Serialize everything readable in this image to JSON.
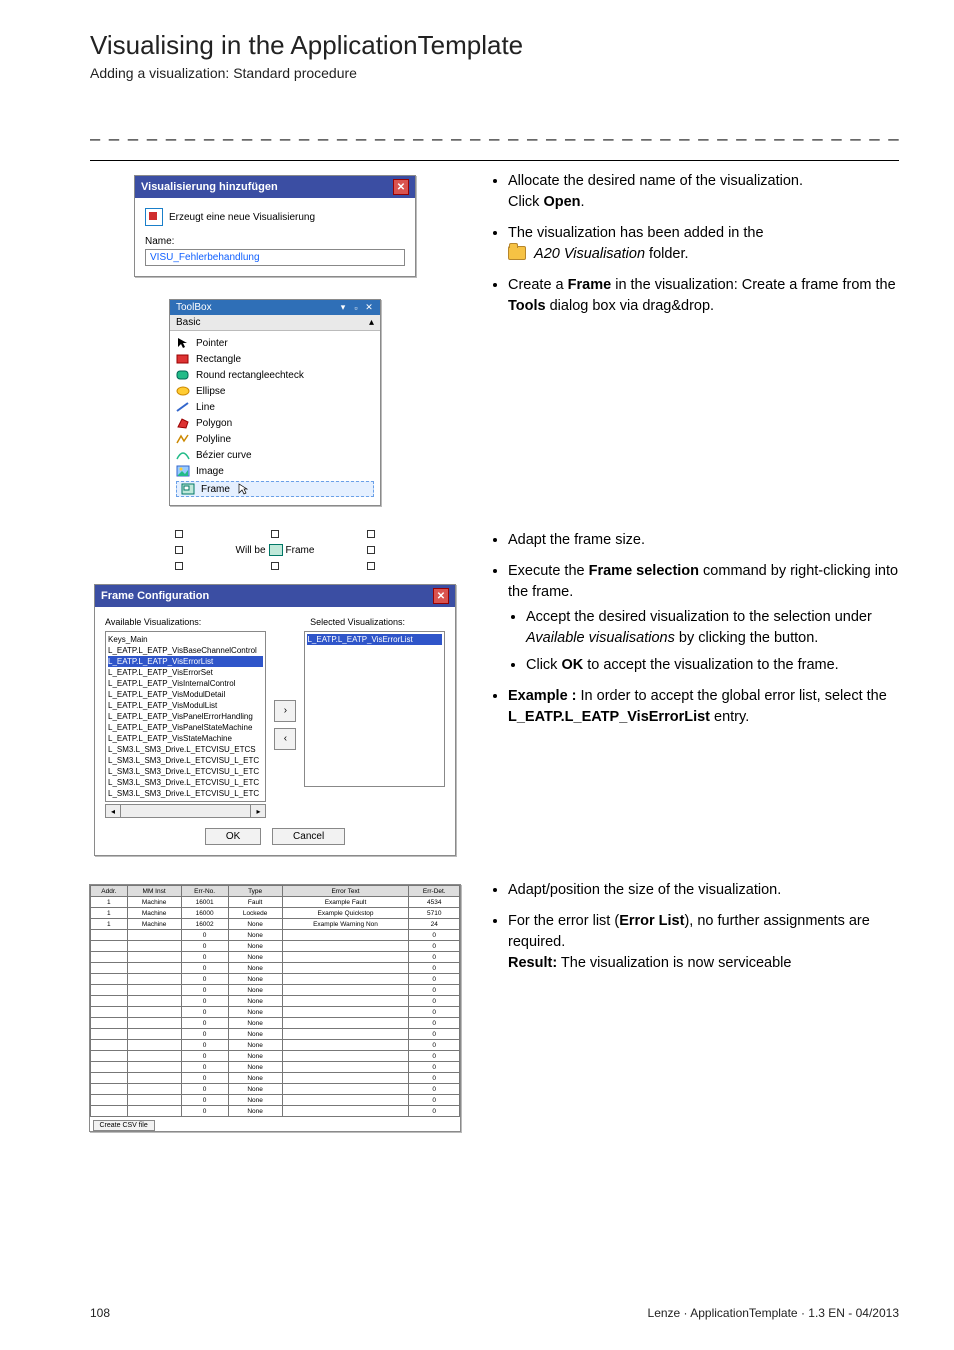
{
  "header": {
    "title": "Visualising in the ApplicationTemplate",
    "subtitle": "Adding a visualization: Standard procedure",
    "dashes": "_ _ _ _ _ _ _ _ _ _ _ _ _ _ _ _ _ _ _ _ _ _ _ _ _ _ _ _ _ _ _ _ _ _ _ _ _ _ _ _ _ _ _ _ _ _ _ _ _ _ _ _ _ _ _ _ _ _ _ _ _ _ _ _"
  },
  "footer": {
    "page": "108",
    "meta": "Lenze · ApplicationTemplate · 1.3 EN - 04/2013"
  },
  "dlg1": {
    "title": "Visualisierung hinzufügen",
    "desc": "Erzeugt eine neue Visualisierung",
    "name_label": "Name:",
    "name_value": "VISU_Fehlerbehandlung"
  },
  "toolbox": {
    "title": "ToolBox",
    "category": "Basic",
    "items": [
      "Pointer",
      "Rectangle",
      "Round rectangleechteck",
      "Ellipse",
      "Line",
      "Polygon",
      "Polyline",
      "Bézier curve",
      "Image",
      "Frame"
    ]
  },
  "frame_placeholder": {
    "label": "Will be",
    "suffix": "Frame"
  },
  "frameconfig": {
    "title": "Frame Configuration",
    "left_label": "Available Visualizations:",
    "right_label": "Selected Visualizations:",
    "available": [
      "Keys_Main",
      "L_EATP.L_EATP_VisBaseChannelControl",
      "L_EATP.L_EATP_VisErrorList",
      "L_EATP.L_EATP_VisErrorSet",
      "L_EATP.L_EATP_VisInternalControl",
      "L_EATP.L_EATP_VisModulDetail",
      "L_EATP.L_EATP_VisModulList",
      "L_EATP.L_EATP_VisPanelErrorHandling",
      "L_EATP.L_EATP_VisPanelStateMachine",
      "L_EATP.L_EATP_VisStateMachine",
      "L_SM3.L_SM3_Drive.L_ETCVISU_ETCS",
      "L_SM3.L_SM3_Drive.L_ETCVISU_L_ETC",
      "L_SM3.L_SM3_Drive.L_ETCVISU_L_ETC",
      "L_SM3.L_SM3_Drive.L_ETCVISU_L_ETC",
      "L_SM3.L_SM3_Drive.L_ETCVISU_L_ETC"
    ],
    "selected": [
      "L_EATP.L_EATP_VisErrorList"
    ],
    "ok": "OK",
    "cancel": "Cancel"
  },
  "errortable": {
    "headers": [
      "Addr.",
      "MM Inst",
      "Err-No.",
      "Type",
      "Error Text",
      "Err-Det."
    ],
    "rows": [
      [
        "1",
        "Machine",
        "16001",
        "Fault",
        "Example Fault",
        "4534"
      ],
      [
        "1",
        "Machine",
        "16000",
        "Lockede",
        "Example Quickstop",
        "5710"
      ],
      [
        "1",
        "Machine",
        "16002",
        "None",
        "Example Warning Non",
        "24"
      ],
      [
        "",
        "",
        "0",
        "None",
        "",
        "0"
      ],
      [
        "",
        "",
        "0",
        "None",
        "",
        "0"
      ],
      [
        "",
        "",
        "0",
        "None",
        "",
        "0"
      ],
      [
        "",
        "",
        "0",
        "None",
        "",
        "0"
      ],
      [
        "",
        "",
        "0",
        "None",
        "",
        "0"
      ],
      [
        "",
        "",
        "0",
        "None",
        "",
        "0"
      ],
      [
        "",
        "",
        "0",
        "None",
        "",
        "0"
      ],
      [
        "",
        "",
        "0",
        "None",
        "",
        "0"
      ],
      [
        "",
        "",
        "0",
        "None",
        "",
        "0"
      ],
      [
        "",
        "",
        "0",
        "None",
        "",
        "0"
      ],
      [
        "",
        "",
        "0",
        "None",
        "",
        "0"
      ],
      [
        "",
        "",
        "0",
        "None",
        "",
        "0"
      ],
      [
        "",
        "",
        "0",
        "None",
        "",
        "0"
      ],
      [
        "",
        "",
        "0",
        "None",
        "",
        "0"
      ],
      [
        "",
        "",
        "0",
        "None",
        "",
        "0"
      ],
      [
        "",
        "",
        "0",
        "None",
        "",
        "0"
      ],
      [
        "",
        "",
        "0",
        "None",
        "",
        "0"
      ]
    ],
    "button": "Create CSV file"
  },
  "text": {
    "s1": {
      "l1a": "Allocate the desired name of the visualization.",
      "l1b_pre": "Click ",
      "l1b_bold": "Open",
      "l1b_post": ".",
      "l2": "The visualization has been added in the",
      "folder_italic": "A20 Visualisation",
      "folder_post": " folder.",
      "l3a_pre": "Create a ",
      "l3a_bold": "Frame",
      "l3a_post": " in the visualization: Create a frame from the ",
      "l3a_bold2": "Tools",
      "l3a_post2": " dialog box via drag&drop."
    },
    "s2": {
      "l1": "Adapt the frame size.",
      "l2_pre": "Execute the ",
      "l2_bold": "Frame selection",
      "l2_post": " command by right-clicking into the frame.",
      "sub1_pre": "Accept the desired visualization to the selection under ",
      "sub1_ital": "Available visualisations",
      "sub1_post": " by clicking the button.",
      "sub2_pre": "Click ",
      "sub2_bold": "OK",
      "sub2_post": " to accept the visualization to the frame.",
      "l3_pre": "",
      "l3_bold": "Example :",
      "l3_post": " In order to accept the global error list, select the ",
      "l3_bold2": "L_EATP.L_EATP_VisErrorList",
      "l3_post2": " entry."
    },
    "s3": {
      "l1": "Adapt/position the size of the visualization.",
      "l2_pre": "For the error list (",
      "l2_bold": "Error List",
      "l2_post": "), no further assignments are required.",
      "res_bold": "Result:",
      "res_post": " The visualization is now serviceable"
    }
  }
}
